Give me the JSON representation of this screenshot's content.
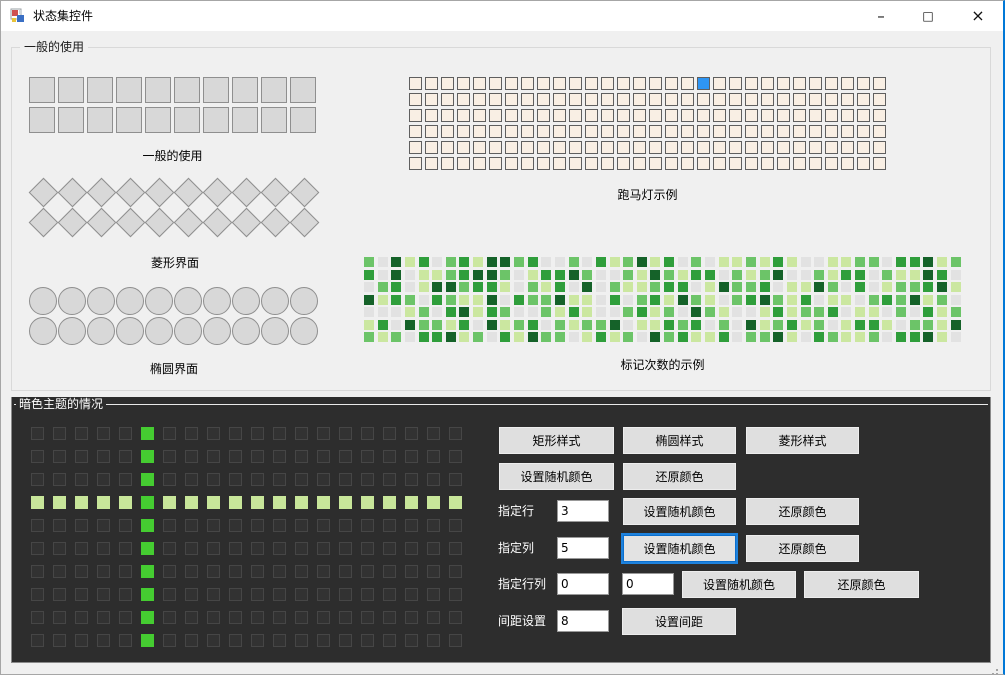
{
  "window": {
    "title": "状态集控件",
    "controls": {
      "minimize": "–",
      "maximize": "□",
      "close": "×"
    }
  },
  "general": {
    "title": "一般的使用",
    "captions": {
      "squares": "一般的使用",
      "diamonds": "菱形界面",
      "ellipses": "椭圆界面",
      "marquee": "跑马灯示例",
      "heatmap": "标记次数的示例"
    },
    "squares": {
      "type": "plain",
      "shape": "sq",
      "rows": 2,
      "cols": 10
    },
    "diamonds": {
      "type": "plain",
      "shape": "di",
      "rows": 2,
      "cols": 10
    },
    "ellipses": {
      "type": "plain",
      "shape": "ci",
      "rows": 2,
      "cols": 10
    },
    "marquee": {
      "type": "marquee",
      "rows": 6,
      "cols": 30,
      "active_row": 0,
      "active_col": 18,
      "active_color": "#2e95f3"
    },
    "heatmap": {
      "type": "heat",
      "palette": [
        "#e2e2e2",
        "#cbe7a0",
        "#6cc468",
        "#2f9e3b",
        "#156229"
      ],
      "pattern": [
        "20413023144230020312413020112131001122033412",
        "30401123442013342002142133021240021330211430",
        "02301442331021304021123301422301142030122341",
        "41320321140322411030231421023421301102324120",
        "00012034132002131002312042100131223011020312",
        "13042213041230212240113230204123120133102214",
        "21203341203142201312042311302241032112033410"
      ]
    }
  },
  "dark": {
    "title": "暗色主题的情况",
    "grid": {
      "type": "dark",
      "rows": 10,
      "cols": 20,
      "highlight_row": 3,
      "highlight_col": 5,
      "row_color": "#c8e69a",
      "col_color": "#45cc31"
    },
    "style_buttons": {
      "rect": "矩形样式",
      "ellipse": "椭圆样式",
      "diamond": "菱形样式"
    },
    "global_buttons": {
      "random": "设置随机颜色",
      "restore": "还原颜色"
    },
    "row_section": {
      "label": "指定行",
      "value": "3",
      "random": "设置随机颜色",
      "restore": "还原颜色"
    },
    "col_section": {
      "label": "指定列",
      "value": "5",
      "random": "设置随机颜色",
      "restore": "还原颜色"
    },
    "rowcol_section": {
      "label": "指定行列",
      "value_row": "0",
      "value_col": "0",
      "random": "设置随机颜色",
      "restore": "还原颜色"
    },
    "spacing_section": {
      "label": "间距设置",
      "value": "8",
      "button": "设置间距"
    }
  }
}
